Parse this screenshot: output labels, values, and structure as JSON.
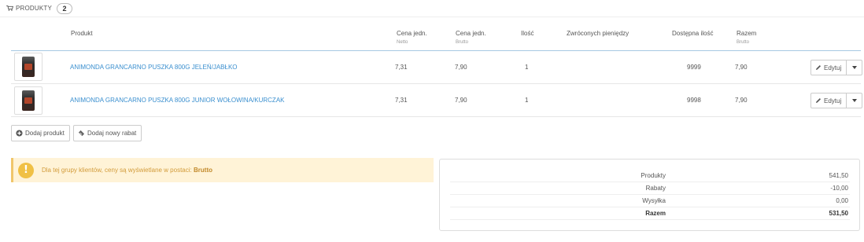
{
  "panel": {
    "title": "PRODUKTY",
    "count": "2"
  },
  "table": {
    "headers": {
      "product": "Produkt",
      "unit_price_net": "Cena jedn.",
      "unit_price_net_sub": "Netto",
      "unit_price_gross": "Cena jedn.",
      "unit_price_gross_sub": "Brutto",
      "quantity": "Ilość",
      "refunded": "Zwróconych pieniędzy",
      "available_qty": "Dostępna ilość",
      "total": "Razem",
      "total_sub": "Brutto"
    },
    "rows": [
      {
        "name": "ANIMONDA GRANCARNO PUSZKA 800G JELEŃ/JABŁKO",
        "price_net": "7,31",
        "price_gross": "7,90",
        "quantity": "1",
        "available": "9999",
        "total": "7,90",
        "edit_label": "Edytuj"
      },
      {
        "name": "ANIMONDA GRANCARNO PUSZKA 800G JUNIOR WOŁOWINA/KURCZAK",
        "price_net": "7,31",
        "price_gross": "7,90",
        "quantity": "1",
        "available": "9998",
        "total": "7,90",
        "edit_label": "Edytuj"
      }
    ]
  },
  "actions": {
    "add_product": "Dodaj produkt",
    "add_discount": "Dodaj nowy rabat"
  },
  "alert": {
    "icon": "!",
    "text": "Dla tej grupy klientów, ceny są wyświetlane w postaci:",
    "strong": "Brutto"
  },
  "totals": {
    "products_label": "Produkty",
    "products_value": "541,50",
    "discounts_label": "Rabaty",
    "discounts_value": "-10,00",
    "shipping_label": "Wysyłka",
    "shipping_value": "0,00",
    "total_label": "Razem",
    "total_value": "531,50"
  },
  "colors": {
    "link": "#3a8fcf",
    "alert_bg": "#fff3d7",
    "alert_icon": "#f0c045",
    "header_line": "#a6c9e2"
  }
}
